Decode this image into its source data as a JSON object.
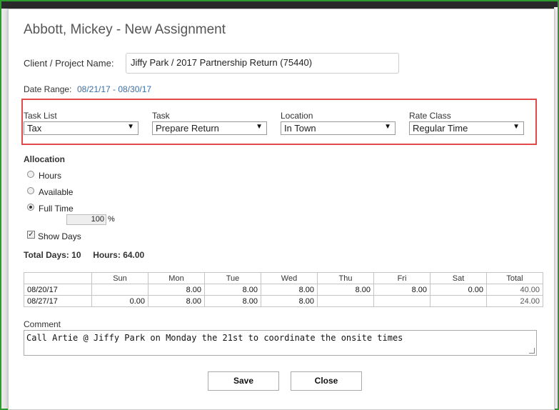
{
  "dialog": {
    "title": "Abbott, Mickey - New Assignment",
    "client_label": "Client / Project Name:",
    "client_value": "Jiffy Park / 2017 Partnership Return (75440)",
    "date_range_label": "Date Range:",
    "date_range_value": "08/21/17 - 08/30/17"
  },
  "selects": [
    {
      "label": "Task List",
      "value": "Tax"
    },
    {
      "label": "Task",
      "value": "Prepare Return"
    },
    {
      "label": "Location",
      "value": "In Town"
    },
    {
      "label": "Rate Class",
      "value": "Regular Time"
    }
  ],
  "allocation": {
    "heading": "Allocation",
    "options": [
      {
        "label": "Hours",
        "selected": false
      },
      {
        "label": "Available",
        "selected": false
      },
      {
        "label": "Full Time",
        "selected": true
      }
    ],
    "percent_value": "100",
    "percent_symbol": "%",
    "show_days_label": "Show Days",
    "show_days_checked": true
  },
  "totals": {
    "days_label": "Total Days:",
    "days_value": "10",
    "hours_label": "Hours:",
    "hours_value": "64.00"
  },
  "table": {
    "headers": [
      "",
      "Sun",
      "Mon",
      "Tue",
      "Wed",
      "Thu",
      "Fri",
      "Sat",
      "Total"
    ],
    "rows": [
      [
        "08/20/17",
        "",
        "8.00",
        "8.00",
        "8.00",
        "8.00",
        "8.00",
        "0.00",
        "40.00"
      ],
      [
        "08/27/17",
        "0.00",
        "8.00",
        "8.00",
        "8.00",
        "",
        "",
        "",
        "24.00"
      ]
    ]
  },
  "comment": {
    "label": "Comment",
    "value": "Call Artie @ Jiffy Park on Monday the 21st to coordinate the onsite times"
  },
  "buttons": {
    "save": "Save",
    "close": "Close"
  },
  "colors": {
    "frame_border": "#2e9b2e",
    "highlight_box": "#e14a4a",
    "link": "#3a6ea5"
  }
}
